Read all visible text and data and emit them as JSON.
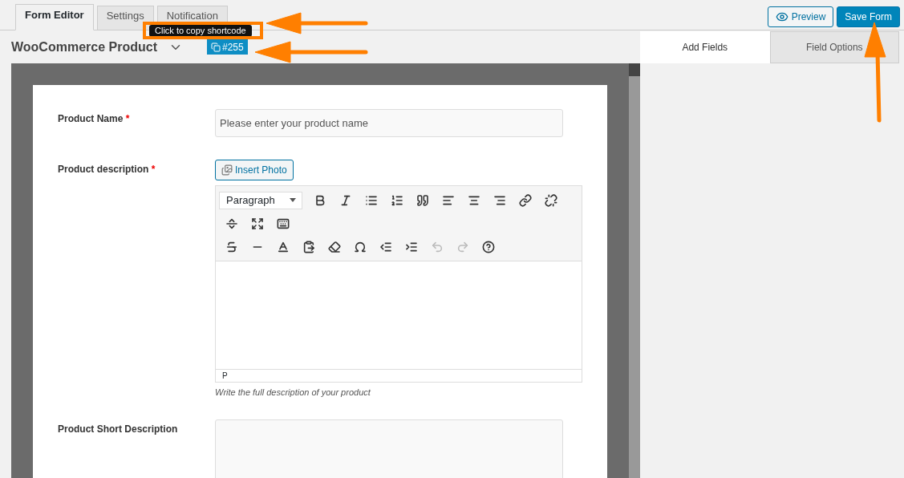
{
  "tabs": [
    {
      "label": "Form Editor",
      "selected": true
    },
    {
      "label": "Settings",
      "selected": false
    },
    {
      "label": "Notification",
      "selected": false
    }
  ],
  "header_buttons": [
    {
      "label": "Preview",
      "kind": "preview"
    },
    {
      "label": "Save Form",
      "kind": "primary"
    }
  ],
  "form_title": "WooCommerce Product",
  "shortcode": {
    "label": "#255",
    "tooltip": "Click to copy shortcode"
  },
  "side_tabs": [
    {
      "label": "Add Fields",
      "selected": true
    },
    {
      "label": "Field Options",
      "selected": false
    }
  ],
  "fields": [
    {
      "kind": "text",
      "label": "Product Name",
      "required_mark": "*",
      "placeholder": "Please enter your product name"
    },
    {
      "kind": "rich",
      "label": "Product description",
      "required_mark": "*",
      "insert_button": "Insert Photo",
      "format": "Paragraph",
      "path": "P",
      "help": "Write the full description of your product",
      "toolbar_rows": [
        [
          {
            "disabled": false
          },
          {
            "disabled": false
          },
          {
            "disabled": false
          },
          {
            "disabled": false
          },
          {
            "disabled": false
          },
          {
            "disabled": false
          },
          {
            "disabled": false
          },
          {
            "disabled": false
          },
          {
            "disabled": false
          },
          {
            "disabled": false
          }
        ],
        [
          {
            "disabled": false
          },
          {
            "disabled": false
          },
          {
            "disabled": false
          }
        ],
        [
          {
            "disabled": false
          },
          {
            "disabled": false
          },
          {
            "disabled": false
          },
          {
            "disabled": false
          },
          {
            "disabled": false
          },
          {
            "disabled": false
          },
          {
            "disabled": false
          },
          {
            "disabled": false
          },
          {
            "disabled": true
          },
          {
            "disabled": true
          },
          {
            "disabled": false
          }
        ]
      ]
    },
    {
      "kind": "textarea",
      "label": "Product Short Description"
    }
  ]
}
